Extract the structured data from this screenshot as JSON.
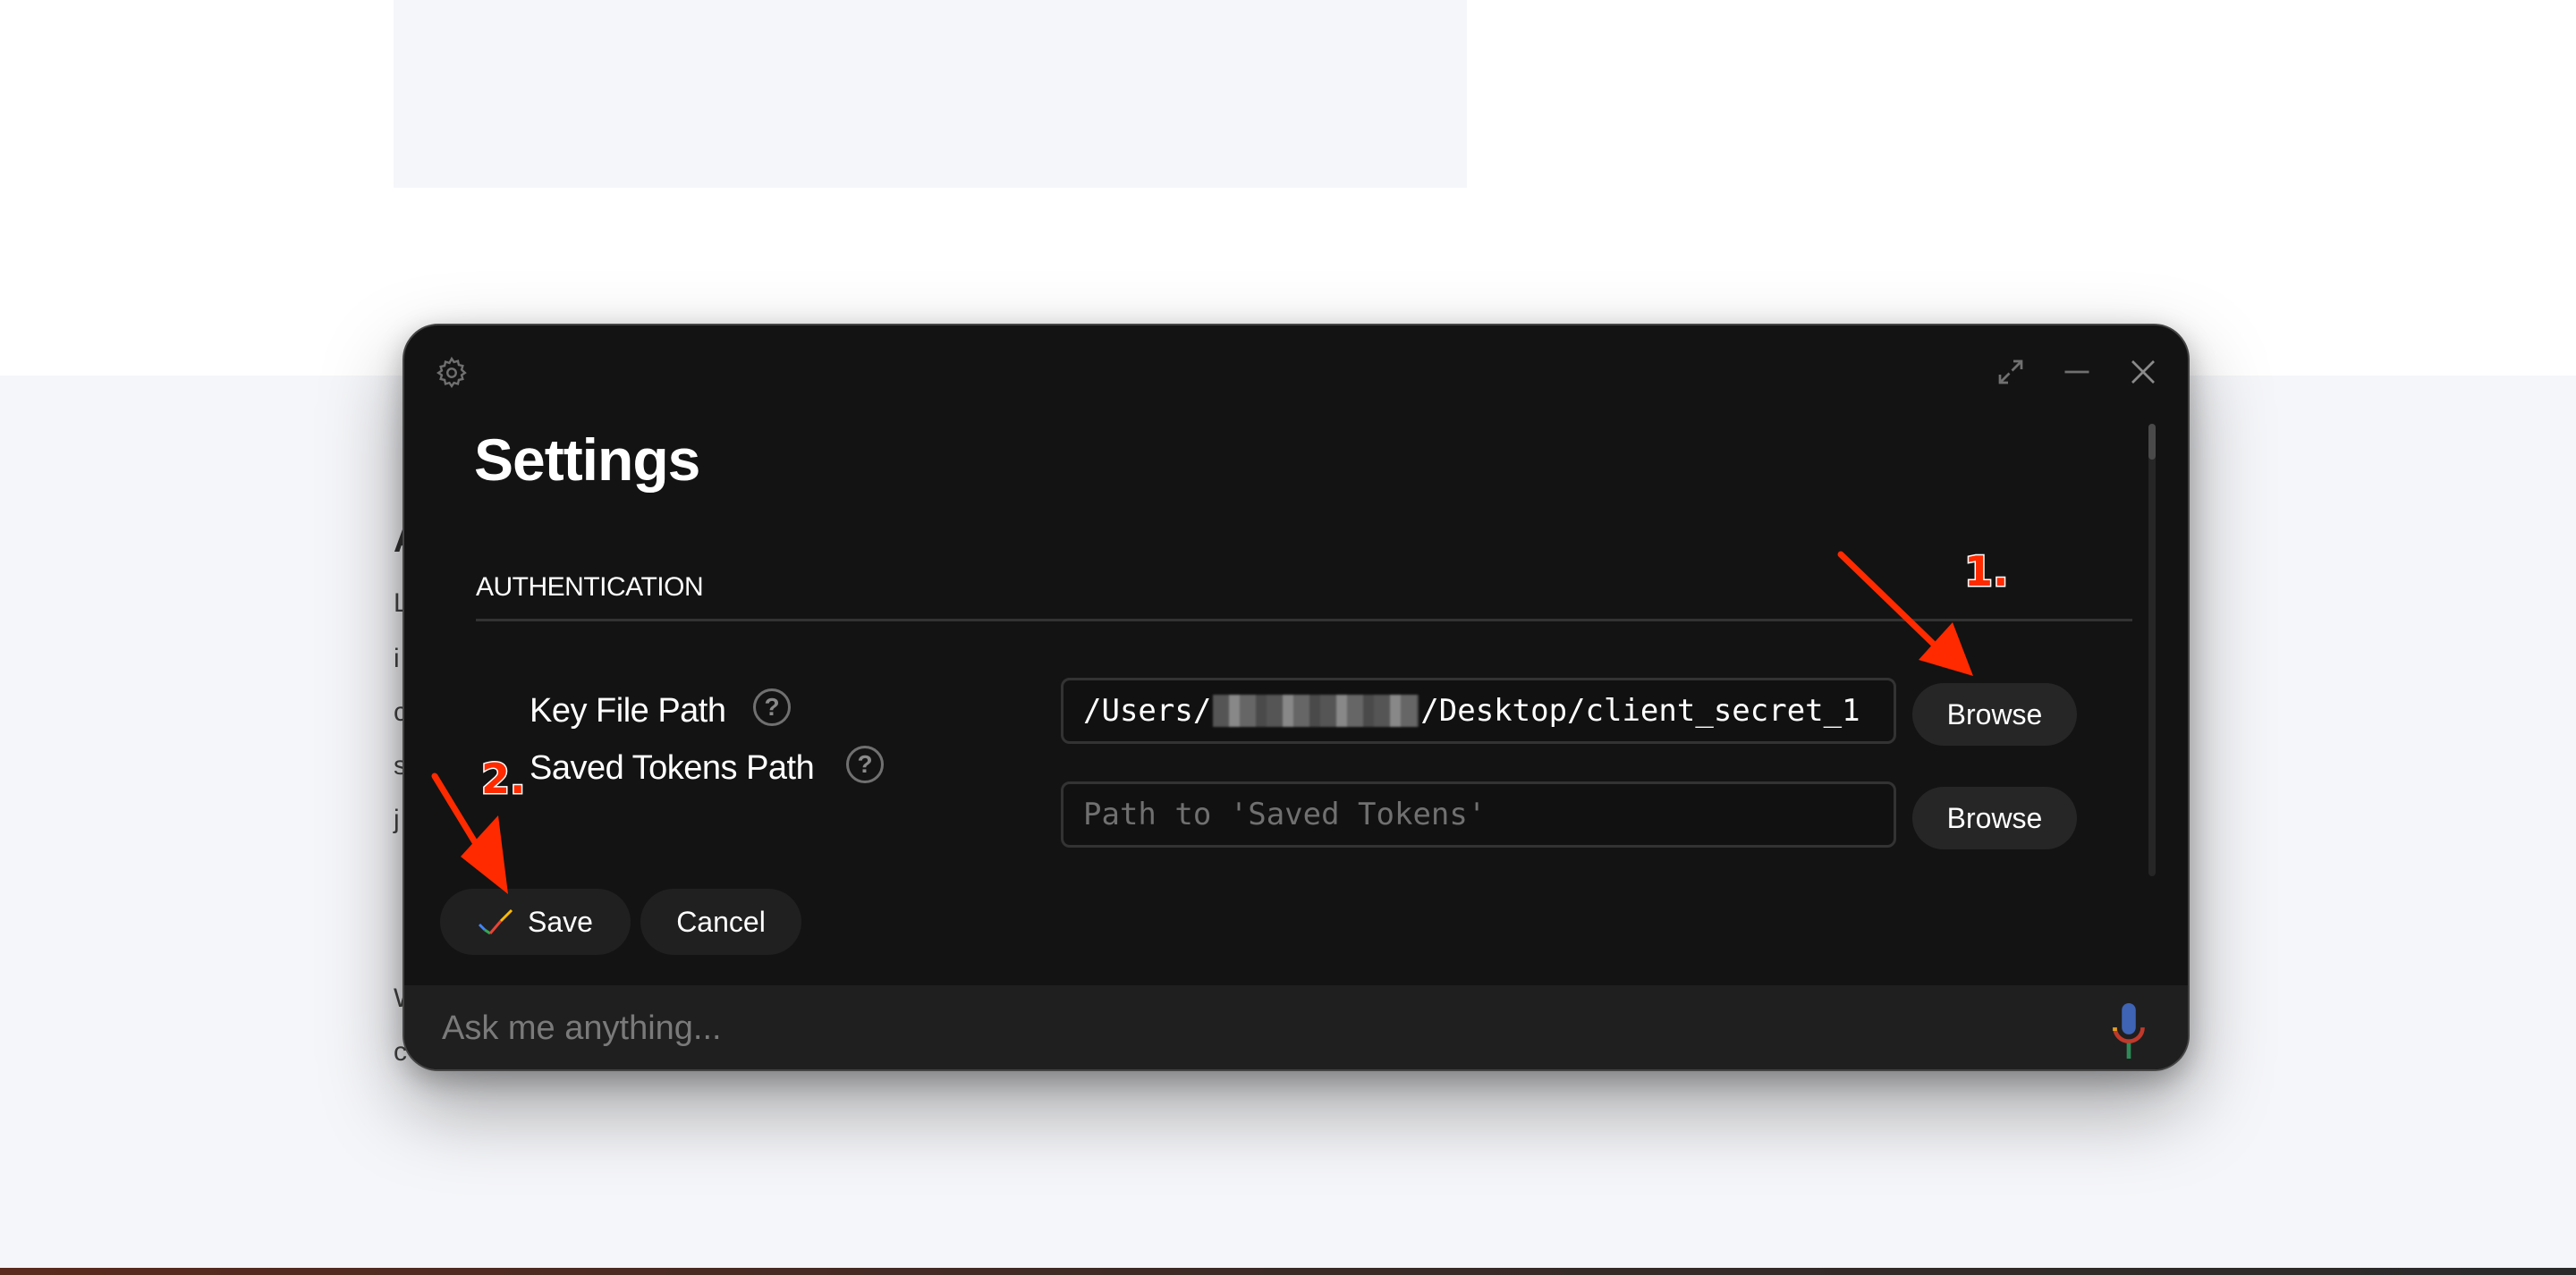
{
  "background_page": {
    "visible_letters": [
      "A",
      "L",
      "i",
      "c",
      "s",
      "j",
      "W",
      "c"
    ]
  },
  "window": {
    "icons": {
      "settings": "gear-icon",
      "expand": "expand-icon",
      "minimize": "minimize-icon",
      "close": "close-icon"
    }
  },
  "settings": {
    "title": "Settings",
    "section_title": "AUTHENTICATION",
    "fields": [
      {
        "label": "Key File Path",
        "help_glyph": "?",
        "value_prefix": "/Users/",
        "value_redacted": true,
        "value_suffix": "/Desktop/client_secret_1",
        "placeholder": "",
        "button": "Browse"
      },
      {
        "label": "Saved Tokens Path",
        "help_glyph": "?",
        "value": "",
        "placeholder": "Path to 'Saved Tokens'",
        "button": "Browse"
      }
    ],
    "save_label": "Save",
    "cancel_label": "Cancel"
  },
  "ask_bar": {
    "placeholder": "Ask me anything...",
    "mic_icon": "microphone-icon"
  },
  "annotations": [
    {
      "label": "1.",
      "target": "Browse (Key File Path)",
      "color": "#ff2a00"
    },
    {
      "label": "2.",
      "target": "Save",
      "color": "#ff2a00"
    }
  ]
}
